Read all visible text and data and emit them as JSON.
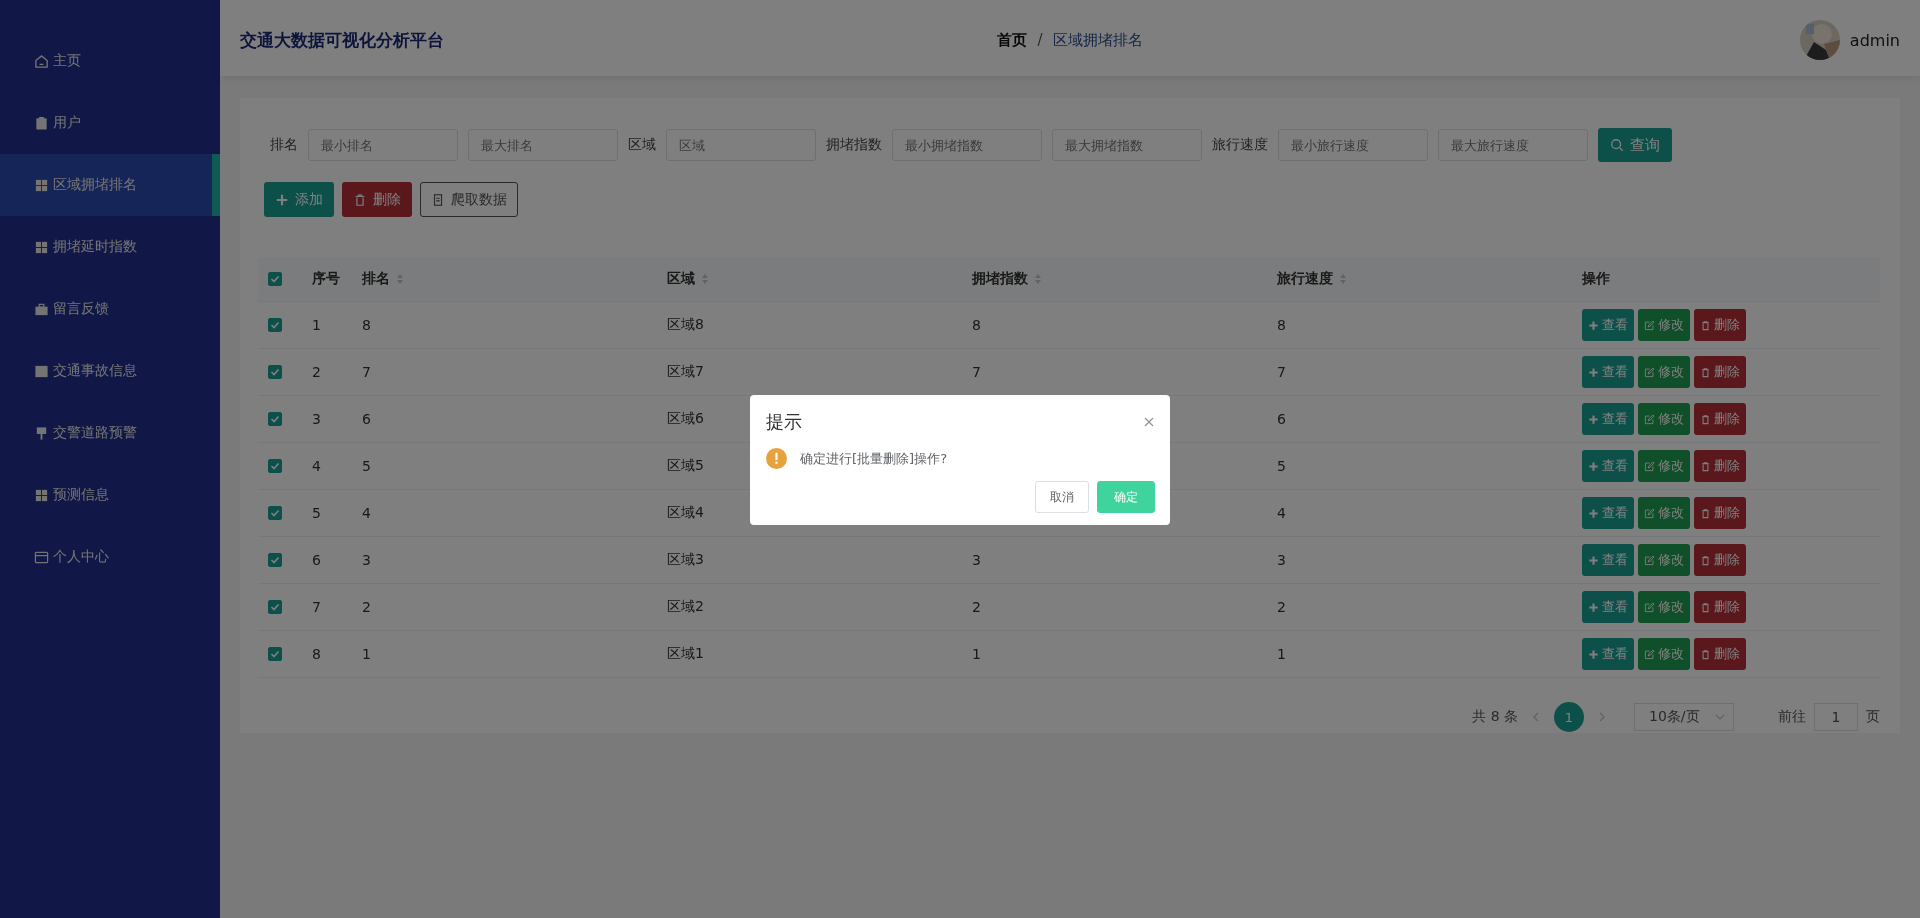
{
  "sidebar": {
    "items": [
      {
        "label": "主页",
        "selected": false
      },
      {
        "label": "用户",
        "selected": false
      },
      {
        "label": "区域拥堵排名",
        "selected": true
      },
      {
        "label": "拥堵延时指数",
        "selected": false
      },
      {
        "label": "留言反馈",
        "selected": false
      },
      {
        "label": "交通事故信息",
        "selected": false
      },
      {
        "label": "交警道路预警",
        "selected": false
      },
      {
        "label": "预测信息",
        "selected": false
      },
      {
        "label": "个人中心",
        "selected": false
      }
    ]
  },
  "header": {
    "title": "交通大数据可视化分析平台",
    "breadcrumb": [
      "首页",
      "区域拥堵排名"
    ],
    "breadcrumb_separator": "/",
    "user": "admin"
  },
  "filters": [
    {
      "label": "排名",
      "placeholders": [
        "最小排名",
        "最大排名"
      ]
    },
    {
      "label": "区域",
      "placeholders": [
        "区域"
      ]
    },
    {
      "label": "拥堵指数",
      "placeholders": [
        "最小拥堵指数",
        "最大拥堵指数"
      ]
    },
    {
      "label": "旅行速度",
      "placeholders": [
        "最小旅行速度",
        "最大旅行速度"
      ]
    }
  ],
  "search_button": "查询",
  "toolbar": [
    {
      "kind": "add",
      "label": "添加"
    },
    {
      "kind": "delete",
      "label": "删除"
    },
    {
      "kind": "crawl",
      "label": "爬取数据"
    }
  ],
  "table": {
    "all_checked": true,
    "columns": [
      {
        "label": "序号",
        "sortable": false
      },
      {
        "label": "排名",
        "sortable": true
      },
      {
        "label": "区域",
        "sortable": true
      },
      {
        "label": "拥堵指数",
        "sortable": true
      },
      {
        "label": "旅行速度",
        "sortable": true
      },
      {
        "label": "操作",
        "sortable": false
      }
    ],
    "rows": [
      {
        "checked": true,
        "cells": [
          "1",
          "8",
          "区域8",
          "8",
          "8"
        ],
        "actions": [
          {
            "kind": "view",
            "label": "查看"
          },
          {
            "kind": "edit",
            "label": "修改"
          },
          {
            "kind": "delete",
            "label": "删除"
          }
        ]
      },
      {
        "checked": true,
        "cells": [
          "2",
          "7",
          "区域7",
          "7",
          "7"
        ],
        "actions": [
          {
            "kind": "view",
            "label": "查看"
          },
          {
            "kind": "edit",
            "label": "修改"
          },
          {
            "kind": "delete",
            "label": "删除"
          }
        ]
      },
      {
        "checked": true,
        "cells": [
          "3",
          "6",
          "区域6",
          "",
          "6"
        ],
        "actions": [
          {
            "kind": "view",
            "label": "查看"
          },
          {
            "kind": "edit",
            "label": "修改"
          },
          {
            "kind": "delete",
            "label": "删除"
          }
        ]
      },
      {
        "checked": true,
        "cells": [
          "4",
          "5",
          "区域5",
          "",
          "5"
        ],
        "actions": [
          {
            "kind": "view",
            "label": "查看"
          },
          {
            "kind": "edit",
            "label": "修改"
          },
          {
            "kind": "delete",
            "label": "删除"
          }
        ]
      },
      {
        "checked": true,
        "cells": [
          "5",
          "4",
          "区域4",
          "",
          "4"
        ],
        "actions": [
          {
            "kind": "view",
            "label": "查看"
          },
          {
            "kind": "edit",
            "label": "修改"
          },
          {
            "kind": "delete",
            "label": "删除"
          }
        ]
      },
      {
        "checked": true,
        "cells": [
          "6",
          "3",
          "区域3",
          "3",
          "3"
        ],
        "actions": [
          {
            "kind": "view",
            "label": "查看"
          },
          {
            "kind": "edit",
            "label": "修改"
          },
          {
            "kind": "delete",
            "label": "删除"
          }
        ]
      },
      {
        "checked": true,
        "cells": [
          "7",
          "2",
          "区域2",
          "2",
          "2"
        ],
        "actions": [
          {
            "kind": "view",
            "label": "查看"
          },
          {
            "kind": "edit",
            "label": "修改"
          },
          {
            "kind": "delete",
            "label": "删除"
          }
        ]
      },
      {
        "checked": true,
        "cells": [
          "8",
          "1",
          "区域1",
          "1",
          "1"
        ],
        "actions": [
          {
            "kind": "view",
            "label": "查看"
          },
          {
            "kind": "edit",
            "label": "修改"
          },
          {
            "kind": "delete",
            "label": "删除"
          }
        ]
      }
    ]
  },
  "pagination": {
    "total": "共 8 条",
    "pages": [
      {
        "label": "1",
        "selected": true
      }
    ],
    "page_size": "10条/页",
    "goto_label": "前往",
    "goto_value": "1",
    "goto_suffix": "页"
  },
  "dialog": {
    "title": "提示",
    "message": "确定进行[批量删除]操作?",
    "cancel": "取消",
    "confirm": "确定"
  }
}
